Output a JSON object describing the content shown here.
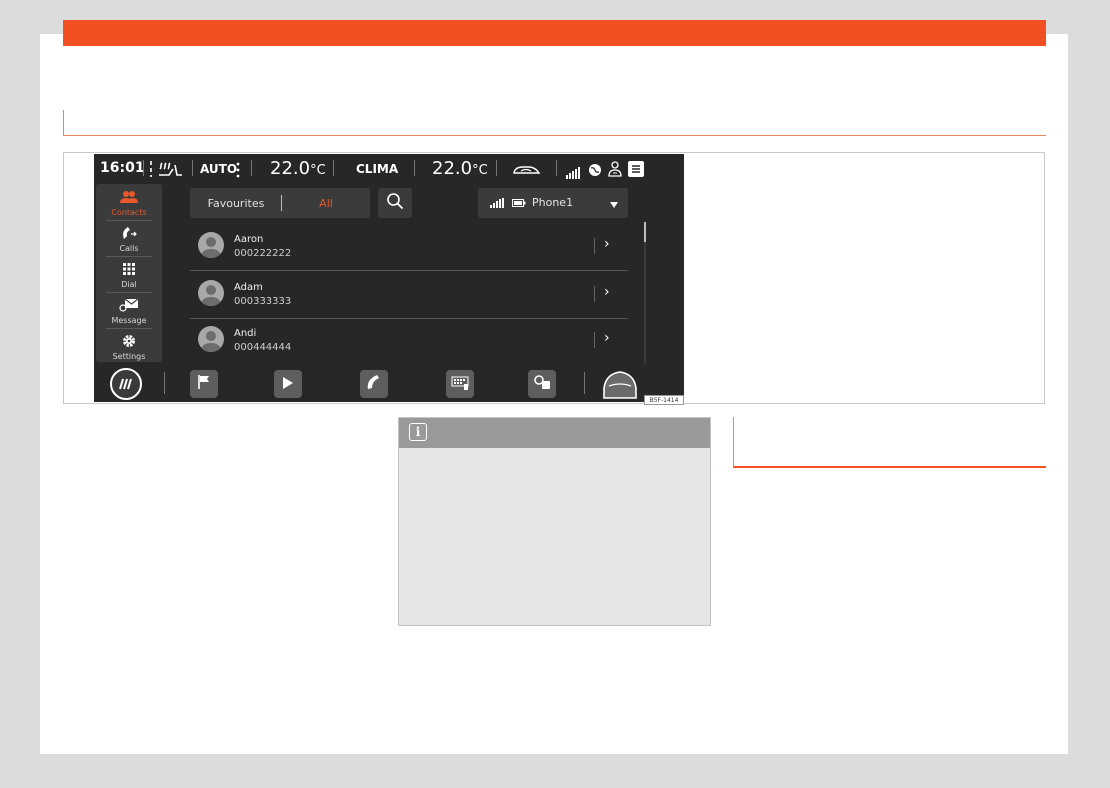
{
  "colors": {
    "brand": "#f25022",
    "screen_bg": "#272727",
    "accent": "#e8582a"
  },
  "status_bar": {
    "time": "16:01",
    "climate_mode": "AUTO",
    "temp_left": "22.0",
    "temp_right": "22.0",
    "unit": "°C",
    "clima_label": "CLIMA"
  },
  "sidebar": {
    "items": [
      {
        "label": "Contacts",
        "icon": "contacts-icon",
        "active": true
      },
      {
        "label": "Calls",
        "icon": "phone-icon"
      },
      {
        "label": "Dial",
        "icon": "dialpad-icon"
      },
      {
        "label": "Message",
        "icon": "message-icon"
      },
      {
        "label": "Settings",
        "icon": "gear-icon"
      }
    ]
  },
  "filter": {
    "favourites_label": "Favourites",
    "all_label": "All"
  },
  "phone_selector": {
    "label": "Phone1"
  },
  "contacts": [
    {
      "name": "Aaron",
      "number": "000222222"
    },
    {
      "name": "Adam",
      "number": "000333333"
    },
    {
      "name": "Andi",
      "number": "000444444"
    }
  ],
  "figure_code": "B5F-1414"
}
